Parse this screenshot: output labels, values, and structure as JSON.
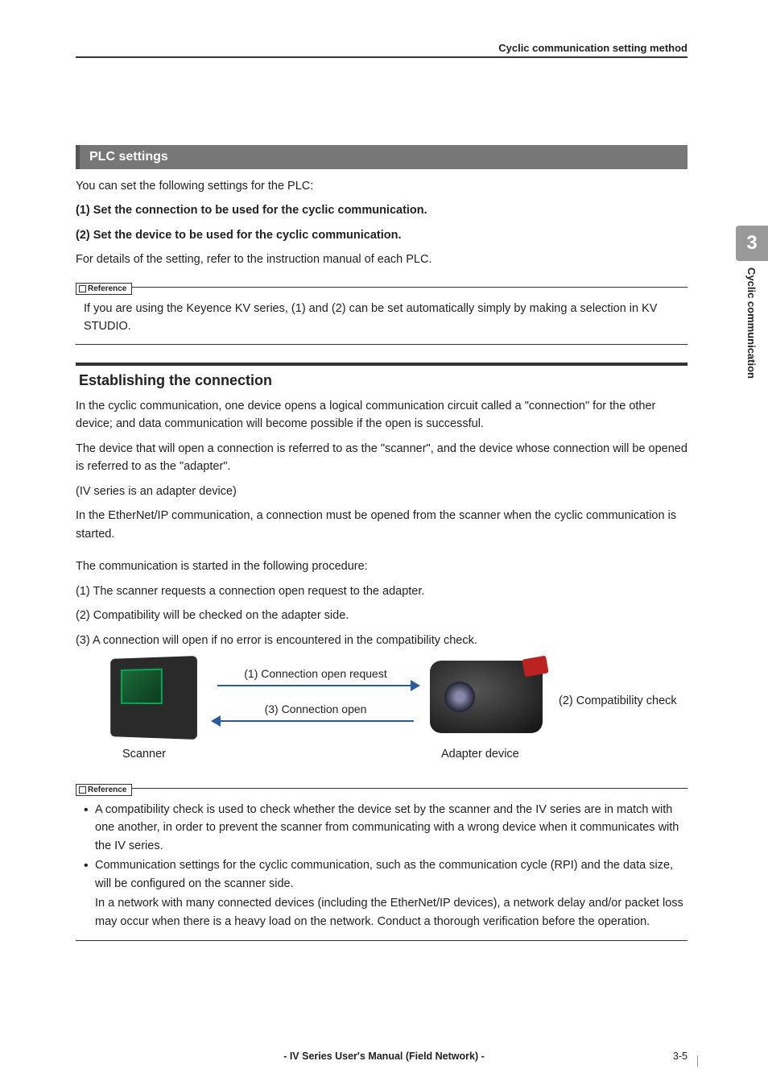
{
  "header": {
    "running_title": "Cyclic communication setting method"
  },
  "side_tab": {
    "chapter_number": "3",
    "chapter_title": "Cyclic communication"
  },
  "section_plc": {
    "title": "PLC settings",
    "intro": "You can set the following settings for the PLC:",
    "item1": "(1) Set the connection to be used for the cyclic communication.",
    "item2": "(2) Set the device to be used for the cyclic communication.",
    "details": "For details of the setting, refer to the instruction manual of each PLC."
  },
  "reference1": {
    "label": "Reference",
    "text": "If you are using the Keyence KV series, (1) and (2) can be set automatically simply by making a selection in KV STUDIO."
  },
  "section_conn": {
    "title": "Establishing the connection",
    "p1": "In the cyclic communication, one device opens a logical communication circuit called a \"connection\" for the other device; and data communication will become possible if the open is successful.",
    "p2": "The device that will open a connection is referred to as the \"scanner\", and the device whose connection will be opened is referred to as the \"adapter\".",
    "p3": "(IV series is an adapter device)",
    "p4": "In the EtherNet/IP communication, a connection must be opened from the scanner when the cyclic communication is started.",
    "p5": "The communication is started in the following procedure:",
    "step1": "(1) The scanner requests a connection open request to the adapter.",
    "step2": "(2) Compatibility will be checked on the adapter side.",
    "step3": "(3) A connection will open if no error is encountered in the compatibility check."
  },
  "diagram": {
    "arrow1": "(1) Connection open request",
    "arrow3": "(3) Connection open",
    "compat": "(2) Compatibility check",
    "scanner": "Scanner",
    "adapter": "Adapter device"
  },
  "reference2": {
    "label": "Reference",
    "b1": "A compatibility check is used to check whether the device set by the scanner and the IV series are in match with one another, in order to prevent the scanner from communicating with a wrong device when it communicates with the IV series.",
    "b2": "Communication settings for the cyclic communication, such as the communication cycle (RPI) and the data size, will be configured on the scanner side.",
    "b2b": "In a network with many connected devices (including the EtherNet/IP devices), a network delay and/or packet loss may occur when there is a heavy load on the network. Conduct a thorough verification before the operation."
  },
  "footer": {
    "center": "- IV Series User's Manual (Field Network) -",
    "page": "3-5"
  }
}
